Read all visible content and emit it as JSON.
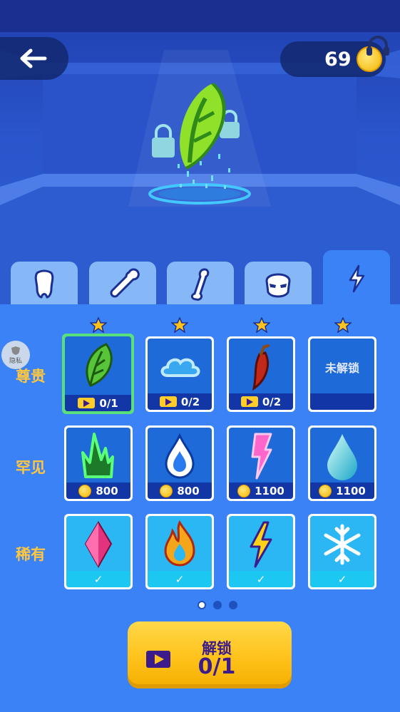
{
  "header": {
    "back_icon": "arrow-left-icon",
    "coins": "69",
    "coin_icon": "coin-icon",
    "support_icon": "headset-icon"
  },
  "tabs": [
    {
      "icon": "tooth-icon",
      "active": false
    },
    {
      "icon": "bone-key-icon",
      "active": false
    },
    {
      "icon": "leg-bone-icon",
      "active": false
    },
    {
      "icon": "mask-icon",
      "active": false
    },
    {
      "icon": "lightning-icon",
      "active": true
    }
  ],
  "privacy": {
    "label": "隐私"
  },
  "rows": [
    {
      "label": "尊贵",
      "items": [
        {
          "icon": "leaf-icon",
          "type": "video",
          "value": "0/1",
          "selected": true,
          "stars": 1
        },
        {
          "icon": "cloud-icon",
          "type": "video",
          "value": "0/2",
          "stars": 1
        },
        {
          "icon": "chili-icon",
          "type": "video",
          "value": "0/2",
          "stars": 1
        },
        {
          "icon": "",
          "type": "locked",
          "value": "未解锁",
          "stars": 1
        }
      ]
    },
    {
      "label": "罕见",
      "items": [
        {
          "icon": "green-flame-icon",
          "type": "coin",
          "value": "800"
        },
        {
          "icon": "water-drop-flame-icon",
          "type": "coin",
          "value": "800"
        },
        {
          "icon": "pink-bolt-icon",
          "type": "coin",
          "value": "1100"
        },
        {
          "icon": "teal-drop-icon",
          "type": "coin",
          "value": "1100"
        }
      ]
    },
    {
      "label": "稀有",
      "items": [
        {
          "icon": "pink-crystal-icon",
          "type": "owned",
          "value": "✓"
        },
        {
          "icon": "fire-icon",
          "type": "owned",
          "value": "✓"
        },
        {
          "icon": "yellow-bolt-icon",
          "type": "owned",
          "value": "✓"
        },
        {
          "icon": "snowflake-icon",
          "type": "owned",
          "value": "✓"
        }
      ]
    }
  ],
  "pagination": {
    "pages": 3,
    "current": 1
  },
  "unlock_button": {
    "label": "解锁",
    "progress": "0/1",
    "icon": "video-play-icon"
  },
  "colors": {
    "panel": "#3a82f5",
    "accent": "#ffc640",
    "selected": "#59e07a",
    "button": "#ffc21a"
  }
}
